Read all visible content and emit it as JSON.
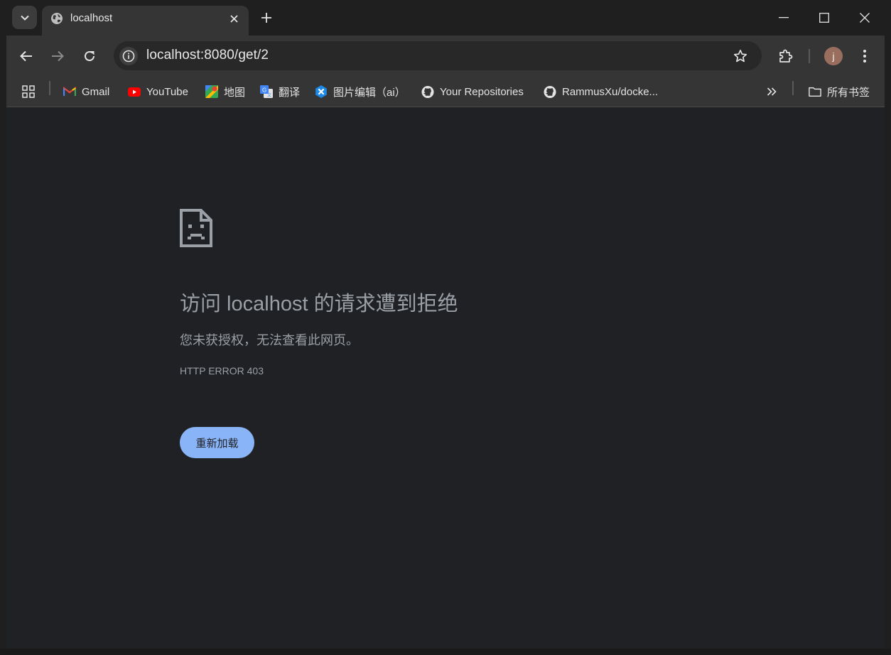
{
  "browser": {
    "tab": {
      "title": "localhost",
      "favicon": "globe-icon"
    },
    "address": {
      "url": "localhost:8080/get/2"
    },
    "profile": {
      "initial": "j"
    }
  },
  "bookmarks": {
    "items": [
      {
        "label": "Gmail",
        "icon": "gmail-icon"
      },
      {
        "label": "YouTube",
        "icon": "youtube-icon"
      },
      {
        "label": "地图",
        "icon": "maps-icon"
      },
      {
        "label": "翻译",
        "icon": "translate-icon"
      },
      {
        "label": "图片编辑（ai）",
        "icon": "image-editor-icon"
      },
      {
        "label": "Your Repositories",
        "icon": "github-icon"
      },
      {
        "label": "RammusXu/docke...",
        "icon": "github-icon"
      }
    ],
    "all_bookmarks_label": "所有书签"
  },
  "error": {
    "title": "访问 localhost 的请求遭到拒绝",
    "subtitle": "您未获授权，无法查看此网页。",
    "code": "HTTP ERROR 403",
    "reload_label": "重新加载",
    "icon": "sad-page-icon"
  },
  "colors": {
    "accent": "#8ab4f8",
    "page_bg": "#202124",
    "text_muted": "#9aa0a6"
  }
}
